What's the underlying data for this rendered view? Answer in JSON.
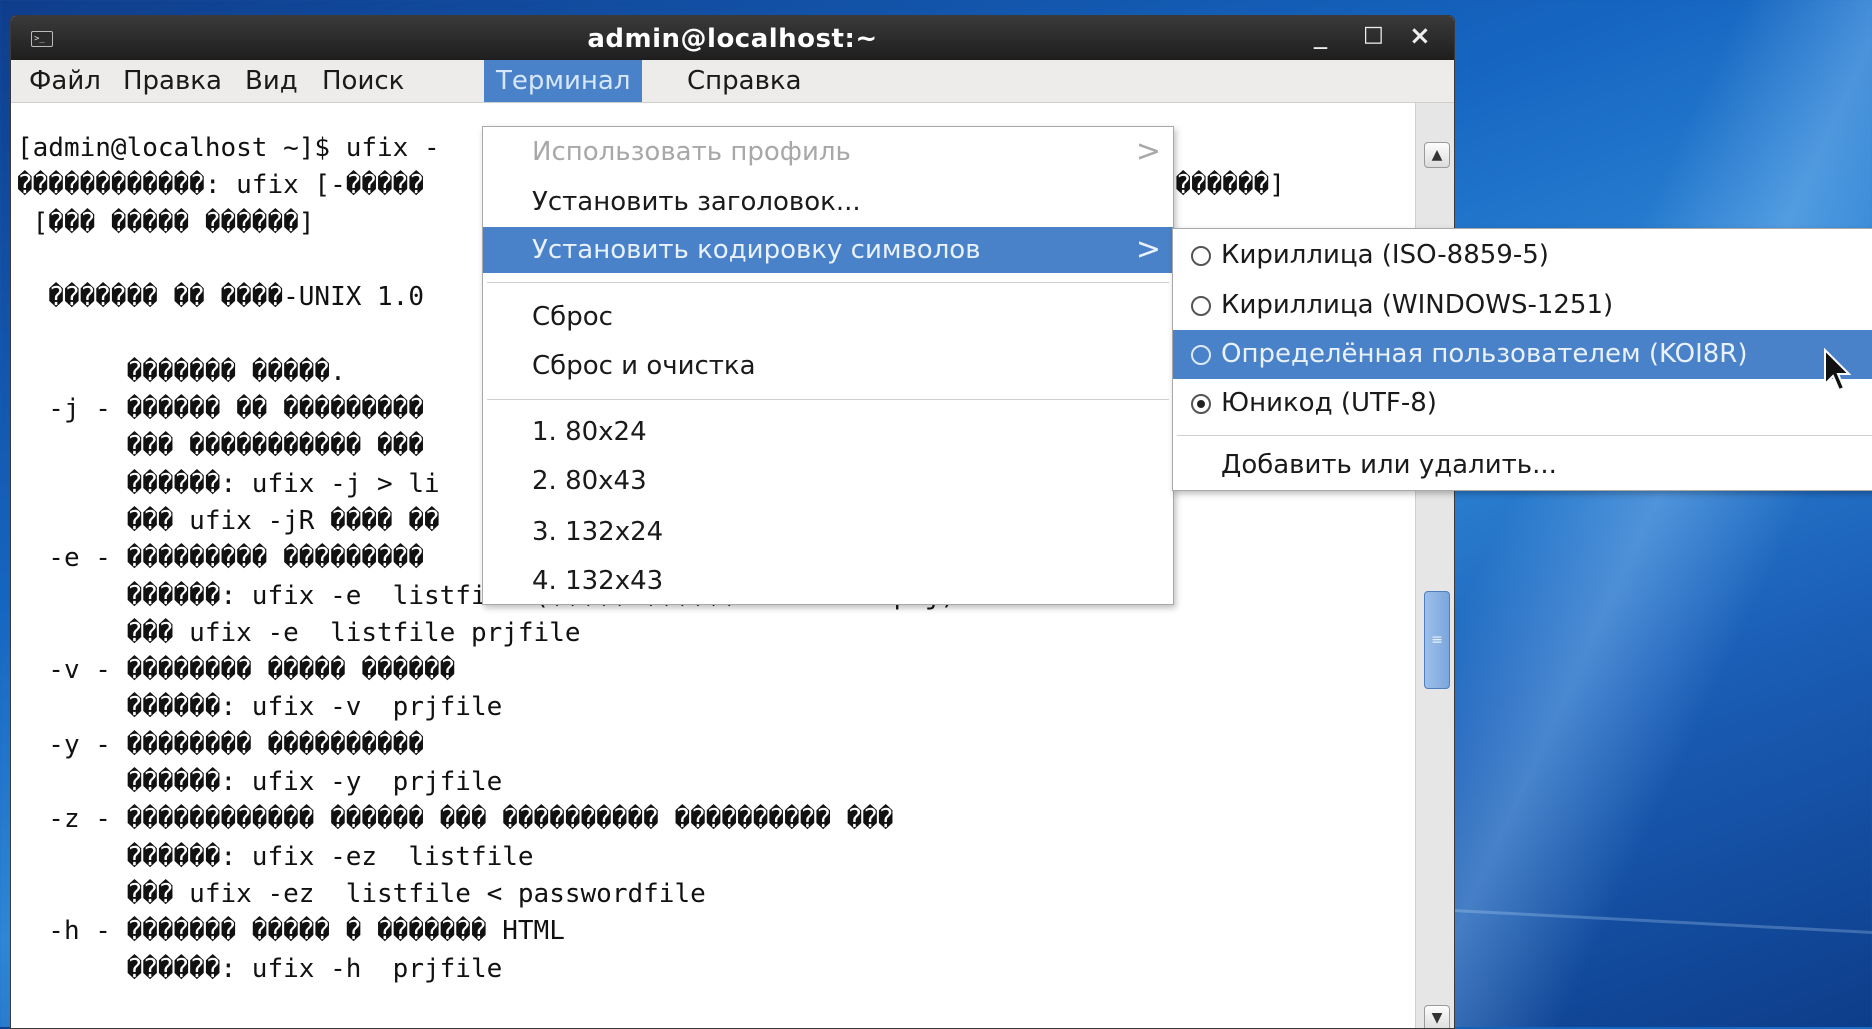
{
  "window": {
    "title": "admin@localhost:~",
    "icon": "terminal-icon",
    "controls": {
      "minimize": "_",
      "maximize": "□",
      "close": "×"
    }
  },
  "menubar": {
    "items": [
      "Файл",
      "Правка",
      "Вид",
      "Поиск",
      "Терминал",
      "Справка"
    ],
    "active": "Терминал"
  },
  "terminal": {
    "lines": [
      "[admin@localhost ~]$ ufix -",
      "������������: ufix [-�����                                          ����� ������]",
      " [��� ����� ������]",
      "",
      "  ������� �� ����-UNIX 1.0",
      "",
      "       ������� �����.",
      "  -j - ������ �� ���������",
      "       ��� ����������� ���",
      "       ������: ufix -j > li",
      "       ��� ufix -jR ���� ��",
      "  -e - ��������� ���������",
      "       ������: ufix -e  listfile (����� ������ listfile.prj)",
      "       ��� ufix -e  listfile prjfile",
      "  -v - �������� ����� ������",
      "       ������: ufix -v  prjfile",
      "  -y - �������� ����������",
      "       ������: ufix -y  prjfile",
      "  -z - ������������ ������ ��� ���������� ���������� ���",
      "       ������: ufix -ez  listfile",
      "       ��� ufix -ez  listfile < passwordfile",
      "  -h - ������� ����� � ������� HTML",
      "       ������: ufix -h  prjfile"
    ]
  },
  "terminal_menu": {
    "items": [
      {
        "label": "Использовать профиль",
        "disabled": true,
        "submenu": true
      },
      {
        "label": "Установить заголовок...",
        "disabled": false,
        "submenu": false
      },
      {
        "label": "Установить кодировку символов",
        "disabled": false,
        "submenu": true,
        "highlighted": true
      },
      {
        "label": "Сброс",
        "disabled": false,
        "submenu": false
      },
      {
        "label": "Сброс и очистка",
        "disabled": false,
        "submenu": false
      },
      {
        "label": "1. 80x24",
        "disabled": false,
        "submenu": false
      },
      {
        "label": "2. 80x43",
        "disabled": false,
        "submenu": false
      },
      {
        "label": "3. 132x24",
        "disabled": false,
        "submenu": false
      },
      {
        "label": "4. 132x43",
        "disabled": false,
        "submenu": false
      }
    ],
    "arrow": ">"
  },
  "encoding_submenu": {
    "items": [
      {
        "label": "Кириллица (ISO-8859-5)",
        "selected": false
      },
      {
        "label": "Кириллица (WINDOWS-1251)",
        "selected": false
      },
      {
        "label": "Определённая пользователем (KOI8R)",
        "selected": false,
        "highlighted": true
      },
      {
        "label": "Юникод (UTF-8)",
        "selected": true
      }
    ],
    "add_remove": "Добавить или удалить..."
  },
  "scrollbar": {
    "up": "^",
    "down": "v",
    "thumb_grip": "≡"
  },
  "colors": {
    "highlight": "#4a82c9",
    "titlebar": "#2a2a2a",
    "desktop": "#1565c0"
  }
}
